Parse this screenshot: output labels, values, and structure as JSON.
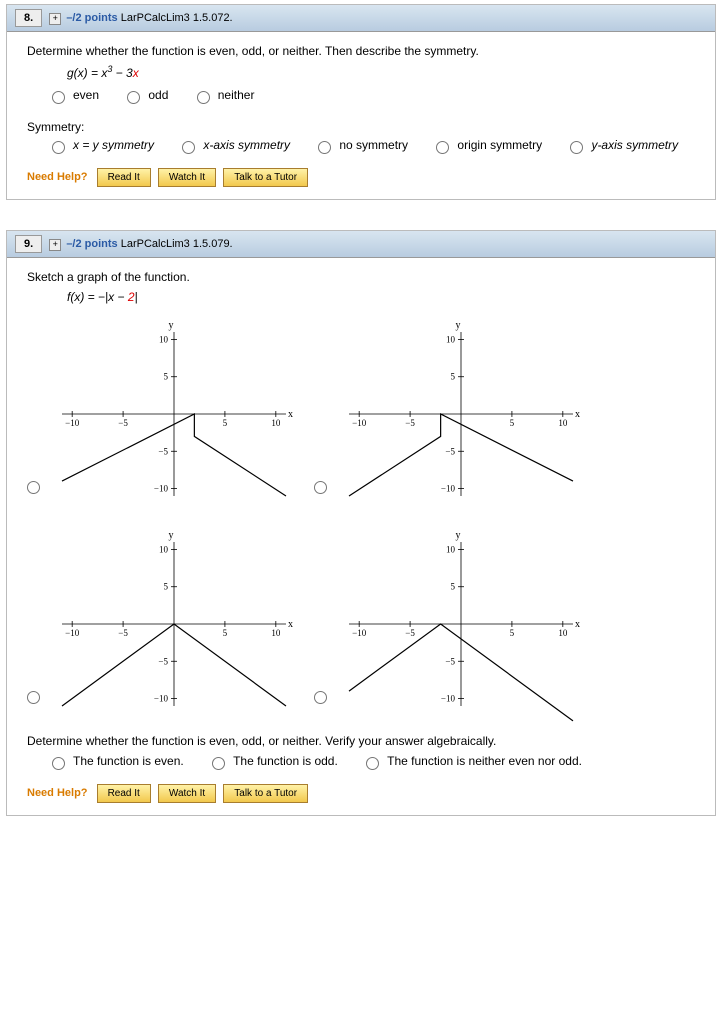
{
  "q8": {
    "number": "8.",
    "points": "–/2 points",
    "ref": "LarPCalcLim3 1.5.072.",
    "prompt": "Determine whether the function is even, odd, or neither. Then describe the symmetry.",
    "formula_lhs": "g(x) = x",
    "formula_exp": "3",
    "formula_rhs": " − 3",
    "formula_var": "x",
    "opts1": [
      "even",
      "odd",
      "neither"
    ],
    "symm_label": "Symmetry:",
    "opts2": [
      "x = y symmetry",
      "x-axis symmetry",
      "no symmetry",
      "origin symmetry",
      "y-axis symmetry"
    ]
  },
  "q9": {
    "number": "9.",
    "points": "–/2 points",
    "ref": "LarPCalcLim3 1.5.079.",
    "prompt": "Sketch a graph of the function.",
    "formula_lhs": "f(x) = −|x − ",
    "formula_const": "2",
    "formula_rhs": "|",
    "verify": "Determine whether the function is even, odd, or neither. Verify your answer algebraically.",
    "opts": [
      "The function is even.",
      "The function is odd.",
      "The function is neither even nor odd."
    ]
  },
  "help": {
    "label": "Need Help?",
    "read": "Read It",
    "watch": "Watch It",
    "tutor": "Talk to a Tutor"
  },
  "chart_data": [
    {
      "type": "line",
      "title": "",
      "xlabel": "x",
      "ylabel": "y",
      "xlim": [
        -11,
        11
      ],
      "ylim": [
        -11,
        11
      ],
      "xticks": [
        -10,
        -5,
        5,
        10
      ],
      "yticks": [
        -10,
        -5,
        5,
        10
      ],
      "series": [
        {
          "name": "f",
          "points": [
            [
              -11,
              -9
            ],
            [
              2,
              0
            ],
            [
              2,
              -3
            ],
            [
              11,
              -11
            ]
          ]
        }
      ]
    },
    {
      "type": "line",
      "title": "",
      "xlabel": "x",
      "ylabel": "y",
      "xlim": [
        -11,
        11
      ],
      "ylim": [
        -11,
        11
      ],
      "xticks": [
        -10,
        -5,
        5,
        10
      ],
      "yticks": [
        -10,
        -5,
        5,
        10
      ],
      "series": [
        {
          "name": "f",
          "points": [
            [
              -11,
              -11
            ],
            [
              -2,
              -3
            ],
            [
              -2,
              0
            ],
            [
              11,
              -9
            ]
          ]
        }
      ]
    },
    {
      "type": "line",
      "title": "",
      "xlabel": "x",
      "ylabel": "y",
      "xlim": [
        -11,
        11
      ],
      "ylim": [
        -11,
        11
      ],
      "xticks": [
        -10,
        -5,
        5,
        10
      ],
      "yticks": [
        -10,
        -5,
        5,
        10
      ],
      "series": [
        {
          "name": "f",
          "points": [
            [
              -11,
              -11
            ],
            [
              0,
              0
            ],
            [
              11,
              -11
            ]
          ]
        }
      ]
    },
    {
      "type": "line",
      "title": "",
      "xlabel": "x",
      "ylabel": "y",
      "xlim": [
        -11,
        11
      ],
      "ylim": [
        -11,
        11
      ],
      "xticks": [
        -10,
        -5,
        5,
        10
      ],
      "yticks": [
        -10,
        -5,
        5,
        10
      ],
      "series": [
        {
          "name": "f",
          "points": [
            [
              -11,
              -9
            ],
            [
              -2,
              0
            ],
            [
              11,
              -13
            ]
          ]
        }
      ]
    }
  ]
}
